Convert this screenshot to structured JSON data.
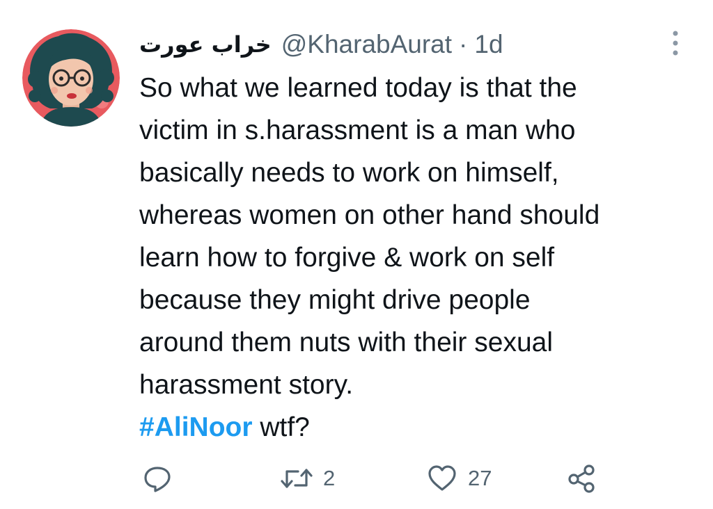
{
  "tweet": {
    "author": {
      "display_name": "خراب عورت",
      "handle": "@KharabAurat",
      "separator": "·",
      "time": "1d"
    },
    "lines": [
      "So what we learned today is that the",
      "victim in s.harassment is a man who",
      "basically needs to work on himself,",
      "whereas women on other hand should",
      "learn how to forgive & work on self",
      "because they might drive people",
      "around them nuts with their sexual",
      "harassment story."
    ],
    "hashtag": "#AliNoor",
    "hashtag_suffix": " wtf?",
    "actions": {
      "reply_icon": "reply-icon",
      "retweet_icon": "retweet-icon",
      "retweet_count": "2",
      "like_icon": "heart-icon",
      "like_count": "27",
      "share_icon": "share-icon"
    },
    "colors": {
      "text": "#0f1419",
      "secondary": "#536471",
      "accent": "#1d9bf0",
      "avatar_bg": "#e85a5f"
    }
  }
}
